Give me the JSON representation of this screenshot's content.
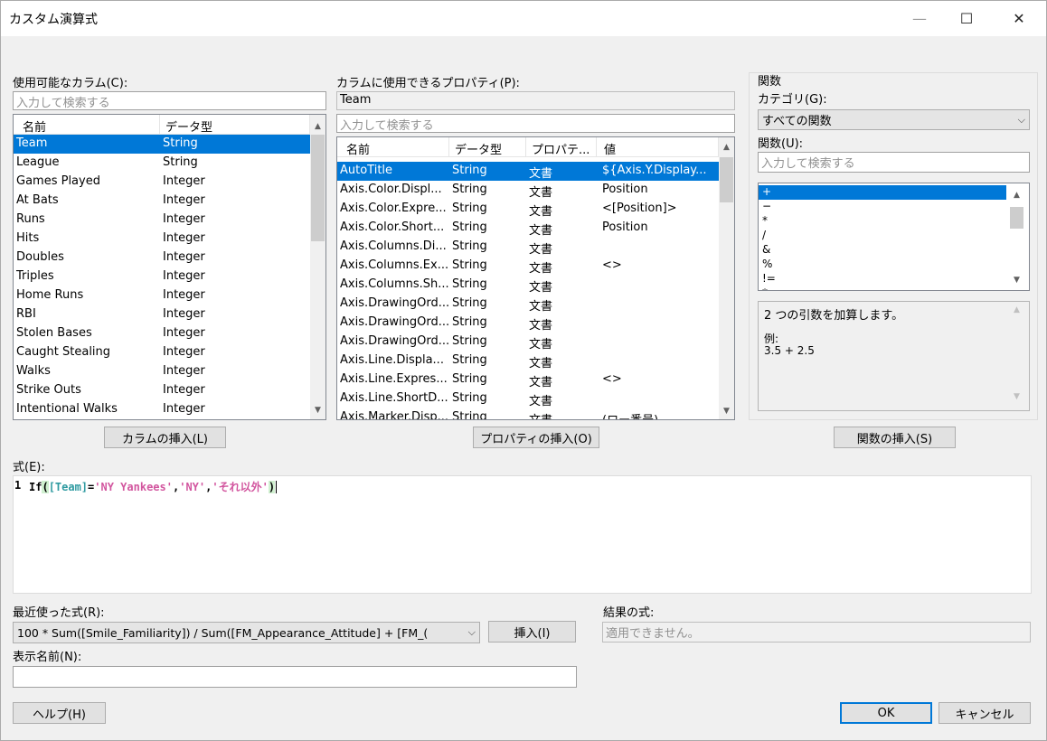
{
  "window": {
    "title": "カスタム演算式",
    "minimize": "—",
    "maximize": "☐",
    "close": "✕"
  },
  "columns": {
    "label": "使用可能なカラム(C):",
    "search_placeholder": "入力して検索する",
    "headers": [
      "名前",
      "データ型"
    ],
    "rows": [
      [
        "Team",
        "String"
      ],
      [
        "League",
        "String"
      ],
      [
        "Games Played",
        "Integer"
      ],
      [
        "At Bats",
        "Integer"
      ],
      [
        "Runs",
        "Integer"
      ],
      [
        "Hits",
        "Integer"
      ],
      [
        "Doubles",
        "Integer"
      ],
      [
        "Triples",
        "Integer"
      ],
      [
        "Home Runs",
        "Integer"
      ],
      [
        "RBI",
        "Integer"
      ],
      [
        "Stolen Bases",
        "Integer"
      ],
      [
        "Caught Stealing",
        "Integer"
      ],
      [
        "Walks",
        "Integer"
      ],
      [
        "Strike Outs",
        "Integer"
      ],
      [
        "Intentional Walks",
        "Integer"
      ]
    ],
    "selected": 0,
    "insert_button": "カラムの挿入(L)"
  },
  "properties": {
    "label": "カラムに使用できるプロパティ(P):",
    "column_name": "Team",
    "search_placeholder": "入力して検索する",
    "headers": [
      "名前",
      "データ型",
      "プロパテ...",
      "値"
    ],
    "rows": [
      [
        "AutoTitle",
        "String",
        "文書",
        "${Axis.Y.Display..."
      ],
      [
        "Axis.Color.Displ...",
        "String",
        "文書",
        "Position"
      ],
      [
        "Axis.Color.Expre...",
        "String",
        "文書",
        "<[Position]>"
      ],
      [
        "Axis.Color.Short...",
        "String",
        "文書",
        "Position"
      ],
      [
        "Axis.Columns.Di...",
        "String",
        "文書",
        ""
      ],
      [
        "Axis.Columns.Ex...",
        "String",
        "文書",
        "<>"
      ],
      [
        "Axis.Columns.Sh...",
        "String",
        "文書",
        ""
      ],
      [
        "Axis.DrawingOrd...",
        "String",
        "文書",
        ""
      ],
      [
        "Axis.DrawingOrd...",
        "String",
        "文書",
        ""
      ],
      [
        "Axis.DrawingOrd...",
        "String",
        "文書",
        ""
      ],
      [
        "Axis.Line.Displa...",
        "String",
        "文書",
        ""
      ],
      [
        "Axis.Line.Expres...",
        "String",
        "文書",
        "<>"
      ],
      [
        "Axis.Line.ShortD...",
        "String",
        "文書",
        ""
      ],
      [
        "Axis.Marker.Disp...",
        "String",
        "文書",
        "(ロー番号)"
      ]
    ],
    "selected": 0,
    "insert_button": "プロパティの挿入(O)"
  },
  "functions": {
    "group_label": "関数",
    "category_label": "カテゴリ(G):",
    "category_value": "すべての関数",
    "func_label": "関数(U):",
    "search_placeholder": "入力して検索する",
    "items": [
      "+",
      "−",
      "*",
      "/",
      "&",
      "%",
      "!=",
      "*"
    ],
    "selected": 0,
    "description": "2 つの引数を加算します。",
    "example_label": "例:",
    "example_value": "3.5 + 2.5",
    "insert_button": "関数の挿入(S)"
  },
  "expression": {
    "label": "式(E):",
    "line_number": "1",
    "tokens": [
      {
        "text": "If",
        "color": "#000000",
        "bold": true
      },
      {
        "text": "(",
        "color": "#000000",
        "highlight": true
      },
      {
        "text": "[Team]",
        "color": "#2e9aa0"
      },
      {
        "text": "=",
        "color": "#000000"
      },
      {
        "text": "'NY Yankees'",
        "color": "#d2569f"
      },
      {
        "text": ",",
        "color": "#000000"
      },
      {
        "text": "'NY'",
        "color": "#d2569f"
      },
      {
        "text": ",",
        "color": "#000000"
      },
      {
        "text": "'それ以外'",
        "color": "#d2569f"
      },
      {
        "text": ")",
        "color": "#000000",
        "highlight": true
      }
    ]
  },
  "recent": {
    "label": "最近使った式(R):",
    "value": "100 * Sum([Smile_Familiarity]) / Sum([FM_Appearance_Attitude] + [FM_(",
    "insert_button": "挿入(I)"
  },
  "result": {
    "label": "結果の式:",
    "value": "適用できません。"
  },
  "display_name": {
    "label": "表示名前(N):",
    "value": ""
  },
  "footer": {
    "help": "ヘルプ(H)",
    "ok": "OK",
    "cancel": "キャンセル"
  }
}
